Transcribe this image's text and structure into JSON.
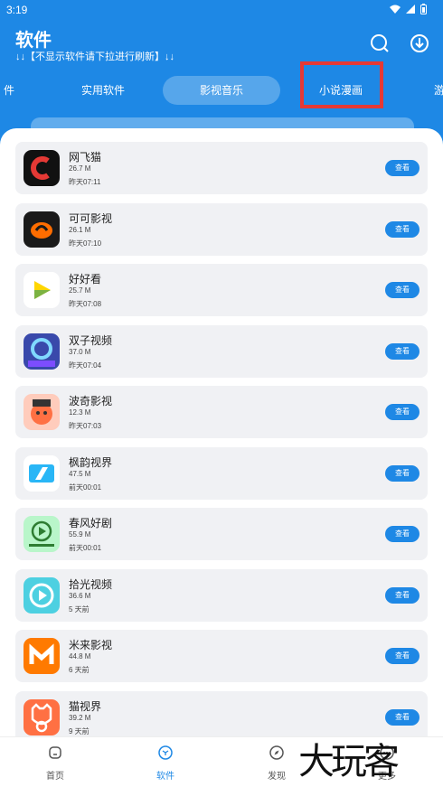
{
  "status": {
    "time": "3:19"
  },
  "header": {
    "title": "软件",
    "subtitle": "↓↓【不显示软件请下拉进行刷新】↓↓"
  },
  "tabs": [
    {
      "label": "件",
      "partial": "left"
    },
    {
      "label": "实用软件"
    },
    {
      "label": "影视音乐",
      "active": true
    },
    {
      "label": "小说漫画",
      "highlighted": true
    },
    {
      "label": "游",
      "partial": "right"
    }
  ],
  "apps": [
    {
      "name": "网飞猫",
      "size": "26.7 M",
      "time": "昨天07:11",
      "button": "查看",
      "icon": "netflix-cat-icon",
      "color": "#111111",
      "accent": "#e53935"
    },
    {
      "name": "可可影视",
      "size": "26.1 M",
      "time": "昨天07:10",
      "button": "查看",
      "icon": "keke-icon",
      "color": "#1a1a1a",
      "accent": "#ff6d00"
    },
    {
      "name": "好好看",
      "size": "25.7 M",
      "time": "昨天07:08",
      "button": "查看",
      "icon": "haohaokan-icon",
      "color": "#ffffff",
      "accent": "#ffd600"
    },
    {
      "name": "双子视频",
      "size": "37.0 M",
      "time": "昨天07:04",
      "button": "查看",
      "icon": "gemini-icon",
      "color": "#3949ab",
      "accent": "#7c4dff"
    },
    {
      "name": "波奇影视",
      "size": "12.3 M",
      "time": "昨天07:03",
      "button": "查看",
      "icon": "boqi-icon",
      "color": "#ffccbc",
      "accent": "#ff7043"
    },
    {
      "name": "枫韵视界",
      "size": "47.5 M",
      "time": "前天00:01",
      "button": "查看",
      "icon": "fengyun-icon",
      "color": "#ffffff",
      "accent": "#29b6f6"
    },
    {
      "name": "春风好剧",
      "size": "55.9 M",
      "time": "前天00:01",
      "button": "查看",
      "icon": "chunfeng-icon",
      "color": "#b9f6ca",
      "accent": "#2e7d32"
    },
    {
      "name": "拾光视频",
      "size": "36.6 M",
      "time": "5 天前",
      "button": "查看",
      "icon": "shiguang-icon",
      "color": "#4dd0e1",
      "accent": "#ffffff"
    },
    {
      "name": "米来影视",
      "size": "44.8 M",
      "time": "6 天前",
      "button": "查看",
      "icon": "milai-icon",
      "color": "#ff7a00",
      "accent": "#ffffff"
    },
    {
      "name": "猫视界",
      "size": "39.2 M",
      "time": "9 天前",
      "button": "查看",
      "icon": "maoshijie-icon",
      "color": "#ff7043",
      "accent": "#ffffff"
    }
  ],
  "nav": [
    {
      "label": "首页",
      "icon": "home-icon"
    },
    {
      "label": "软件",
      "icon": "software-icon",
      "active": true
    },
    {
      "label": "发现",
      "icon": "compass-icon"
    },
    {
      "label": "更多",
      "icon": "more-icon"
    }
  ],
  "watermark": "大玩客",
  "colors": {
    "primary": "#1e88e5",
    "highlight": "#e53935"
  }
}
